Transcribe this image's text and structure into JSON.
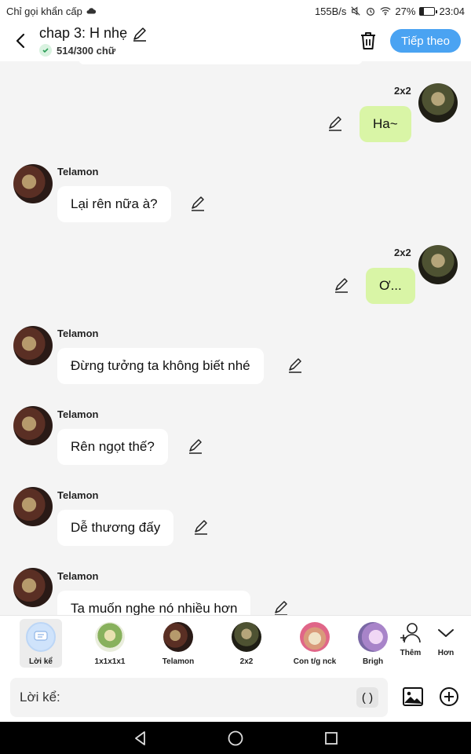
{
  "status_bar": {
    "left_text": "Chỉ gọi khẩn cấp",
    "net_speed": "155B/s",
    "battery": "27%",
    "battery_level": 0.27,
    "time": "23:04"
  },
  "header": {
    "title": "chap 3: H nhẹ",
    "word_count": "514/300 chữ",
    "next_label": "Tiếp theo"
  },
  "messages": [
    {
      "side": "right",
      "name": "2x2",
      "text": "Ha~"
    },
    {
      "side": "left",
      "name": "Telamon",
      "text": "Lại rên nữa à?"
    },
    {
      "side": "right",
      "name": "2x2",
      "text": "Ơ..."
    },
    {
      "side": "left",
      "name": "Telamon",
      "text": "Đừng tưởng ta không biết nhé"
    },
    {
      "side": "left",
      "name": "Telamon",
      "text": "Rên ngọt thế?"
    },
    {
      "side": "left",
      "name": "Telamon",
      "text": "Dễ thương đấy"
    },
    {
      "side": "left",
      "name": "Telamon",
      "text": "Ta muốn nghe nó nhiều hơn"
    }
  ],
  "characters": [
    {
      "label": "Lời kể",
      "selected": true
    },
    {
      "label": "1x1x1x1"
    },
    {
      "label": "Telamon"
    },
    {
      "label": "2x2"
    },
    {
      "label": "Con t/g nck"
    },
    {
      "label": "Brigh"
    }
  ],
  "actions": {
    "add_label": "Thêm",
    "more_label": "Hơn"
  },
  "input": {
    "placeholder": "Lời kể:",
    "paren_label": "( )"
  },
  "icons": {
    "back": "back-arrow-icon",
    "edit": "pencil-icon",
    "trash": "trash-icon",
    "image": "image-icon",
    "add": "plus-circle-icon"
  },
  "colors": {
    "accent": "#4aa3f2",
    "own_bubble": "#d9f5a6",
    "other_bubble": "#ffffff"
  }
}
